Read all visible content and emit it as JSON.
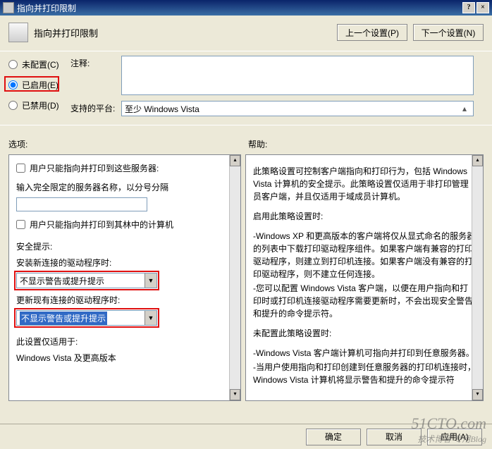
{
  "title": "指向并打印限制",
  "header": {
    "heading": "指向并打印限制",
    "prev_btn": "上一个设置(P)",
    "next_btn": "下一个设置(N)"
  },
  "radios": {
    "not_configured": "未配置(C)",
    "enabled": "已启用(E)",
    "disabled": "已禁用(D)"
  },
  "comment": {
    "label": "注释:",
    "value": ""
  },
  "platform": {
    "label": "支持的平台:",
    "value": "至少 Windows Vista"
  },
  "sections": {
    "options": "选项:",
    "help": "帮助:"
  },
  "options": {
    "chk_servers": "用户只能指向并打印到这些服务器:",
    "hint_servers": "输入完全限定的服务器名称，以分号分隔",
    "server_input": "",
    "chk_forest": "用户只能指向并打印到其林中的计算机",
    "security_hint": "安全提示:",
    "install_label": "安装新连接的驱动程序时:",
    "combo1": "不显示警告或提升提示",
    "update_label": "更新现有连接的驱动程序时:",
    "combo2": "不显示警告或提升提示",
    "applies_label": "此设置仅适用于:",
    "applies_value": "Windows Vista 及更高版本"
  },
  "help": {
    "p1": "此策略设置可控制客户端指向和打印行为，包括 Windows Vista 计算机的安全提示。此策略设置仅适用于非打印管理员客户端，并且仅适用于域成员计算机。",
    "p2_title": "启用此策略设置时:",
    "p2_l1": "-Windows XP 和更高版本的客户端将仅从显式命名的服务器的列表中下载打印驱动程序组件。如果客户端有兼容的打印驱动程序，则建立到打印机连接。如果客户端没有兼容的打印驱动程序，则不建立任何连接。",
    "p2_l2": "-您可以配置 Windows Vista 客户端，以便在用户指向和打印时或打印机连接驱动程序需要更新时，不会出现安全警告和提升的命令提示符。",
    "p3_title": "未配置此策略设置时:",
    "p3_l1": "-Windows Vista 客户端计算机可指向并打印到任意服务器。",
    "p3_l2": "-当用户使用指向和打印创建到任意服务器的打印机连接时，Windows Vista 计算机将显示警告和提升的命令提示符"
  },
  "buttons": {
    "ok": "确定",
    "cancel": "取消",
    "apply": "应用(A)"
  },
  "watermark": {
    "main": "51CTO.com",
    "sub": "技术博客   专用Blog"
  }
}
